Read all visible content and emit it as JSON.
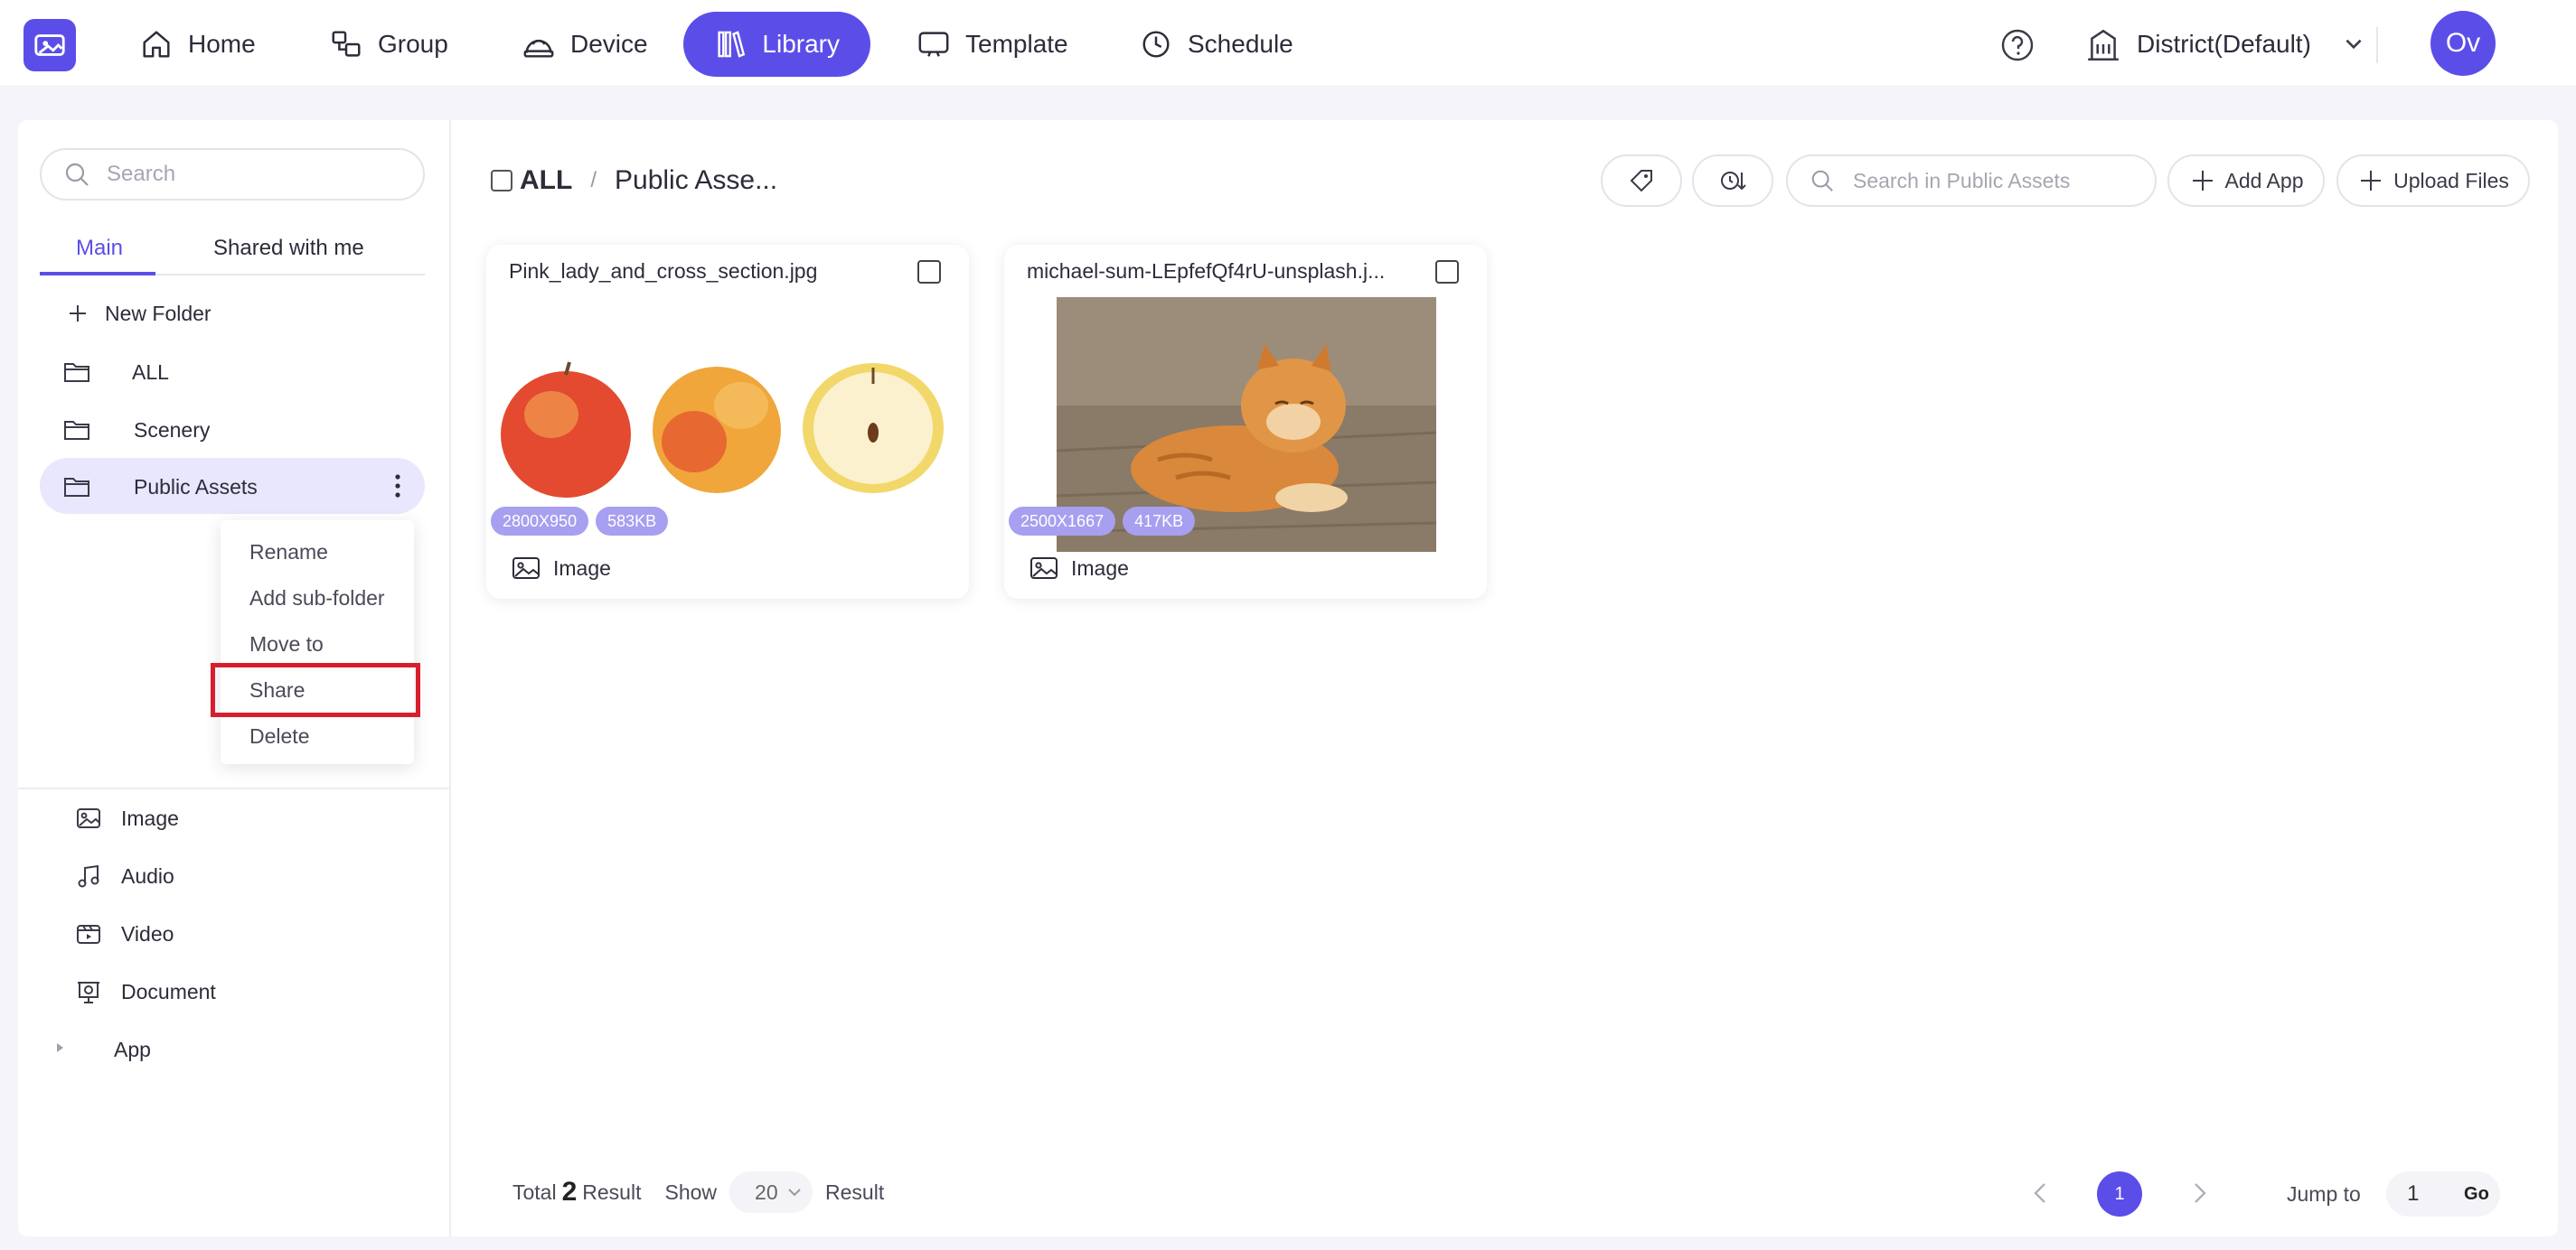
{
  "nav": {
    "items": [
      {
        "label": "Home",
        "icon": "home-icon"
      },
      {
        "label": "Group",
        "icon": "group-icon"
      },
      {
        "label": "Device",
        "icon": "device-icon"
      },
      {
        "label": "Library",
        "icon": "library-icon",
        "active": true
      },
      {
        "label": "Template",
        "icon": "template-icon"
      },
      {
        "label": "Schedule",
        "icon": "schedule-icon"
      }
    ],
    "district": "District(Default)",
    "avatar": "Ov",
    "accent": "#5b4ee8"
  },
  "sidebar": {
    "search_placeholder": "Search",
    "tabs": [
      {
        "label": "Main",
        "active": true
      },
      {
        "label": "Shared with me"
      }
    ],
    "new_folder": "New Folder",
    "folders": [
      {
        "label": "ALL"
      },
      {
        "label": "Scenery"
      },
      {
        "label": "Public Assets",
        "selected": true
      }
    ],
    "context_menu": [
      {
        "label": "Rename"
      },
      {
        "label": "Add sub-folder"
      },
      {
        "label": "Move to"
      },
      {
        "label": "Share",
        "highlighted": true
      },
      {
        "label": "Delete"
      }
    ],
    "types": [
      {
        "label": "Image",
        "icon": "image-icon"
      },
      {
        "label": "Audio",
        "icon": "music-icon"
      },
      {
        "label": "Video",
        "icon": "video-icon"
      },
      {
        "label": "Document",
        "icon": "document-icon"
      },
      {
        "label": "App",
        "icon": "app-caret-icon"
      }
    ]
  },
  "main": {
    "breadcrumb": {
      "root": "ALL",
      "separator": "/",
      "current": "Public Asse..."
    },
    "search_placeholder": "Search in Public Assets",
    "add_app": "Add App",
    "upload_files": "Upload Files",
    "assets": [
      {
        "name": "Pink_lady_and_cross_section.jpg",
        "dimensions": "2800X950",
        "size": "583KB",
        "type": "Image"
      },
      {
        "name": "michael-sum-LEpfefQf4rU-unsplash.j...",
        "dimensions": "2500X1667",
        "size": "417KB",
        "type": "Image"
      }
    ],
    "footer": {
      "total_prefix": "Total",
      "total_count": "2",
      "total_suffix": "Result",
      "show_label": "Show",
      "show_value": "20",
      "show_suffix": "Result",
      "current_page": "1",
      "jump_label": "Jump to",
      "jump_value": "1",
      "go": "Go"
    }
  }
}
